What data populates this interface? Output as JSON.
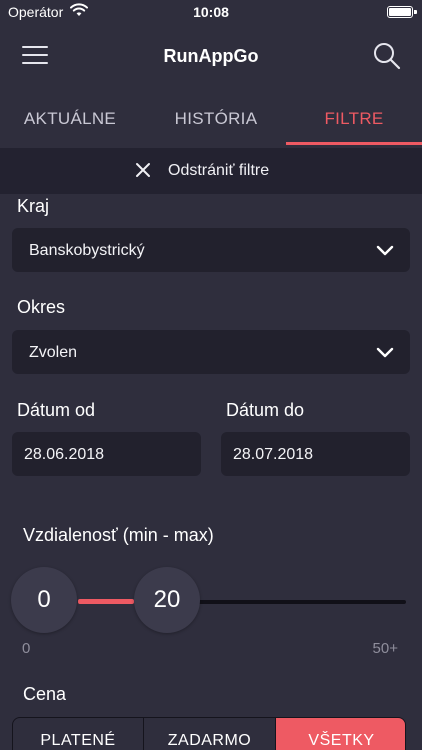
{
  "status_bar": {
    "carrier": "Operátor",
    "time": "10:08",
    "wifi_icon": "wifi-icon",
    "battery_icon": "battery-icon"
  },
  "header": {
    "title": "RunAppGo",
    "menu_icon": "hamburger-menu-icon",
    "search_icon": "search-icon"
  },
  "tabs": [
    {
      "label": "AKTUÁLNE",
      "active": false
    },
    {
      "label": "HISTÓRIA",
      "active": false
    },
    {
      "label": "FILTRE",
      "active": true
    }
  ],
  "remove_filters": {
    "label": "Odstrániť filtre",
    "icon": "close-icon"
  },
  "filters": {
    "region": {
      "label": "Kraj",
      "value": "Banskobystrický"
    },
    "district": {
      "label": "Okres",
      "value": "Zvolen"
    },
    "date_from": {
      "label": "Dátum od",
      "value": "28.06.2018"
    },
    "date_to": {
      "label": "Dátum do",
      "value": "28.07.2018"
    },
    "distance": {
      "label": "Vzdialenosť (min - max)",
      "min_value": "0",
      "max_value": "20",
      "range_min_label": "0",
      "range_max_label": "50+"
    },
    "price": {
      "label": "Cena",
      "options": [
        "PLATENÉ",
        "ZADARMO",
        "VŠETKY"
      ],
      "selected": "VŠETKY"
    }
  },
  "colors": {
    "background": "#2f2e3d",
    "accent": "#ee5a63",
    "field_bg": "#22212d",
    "bar_bg": "#232230"
  }
}
